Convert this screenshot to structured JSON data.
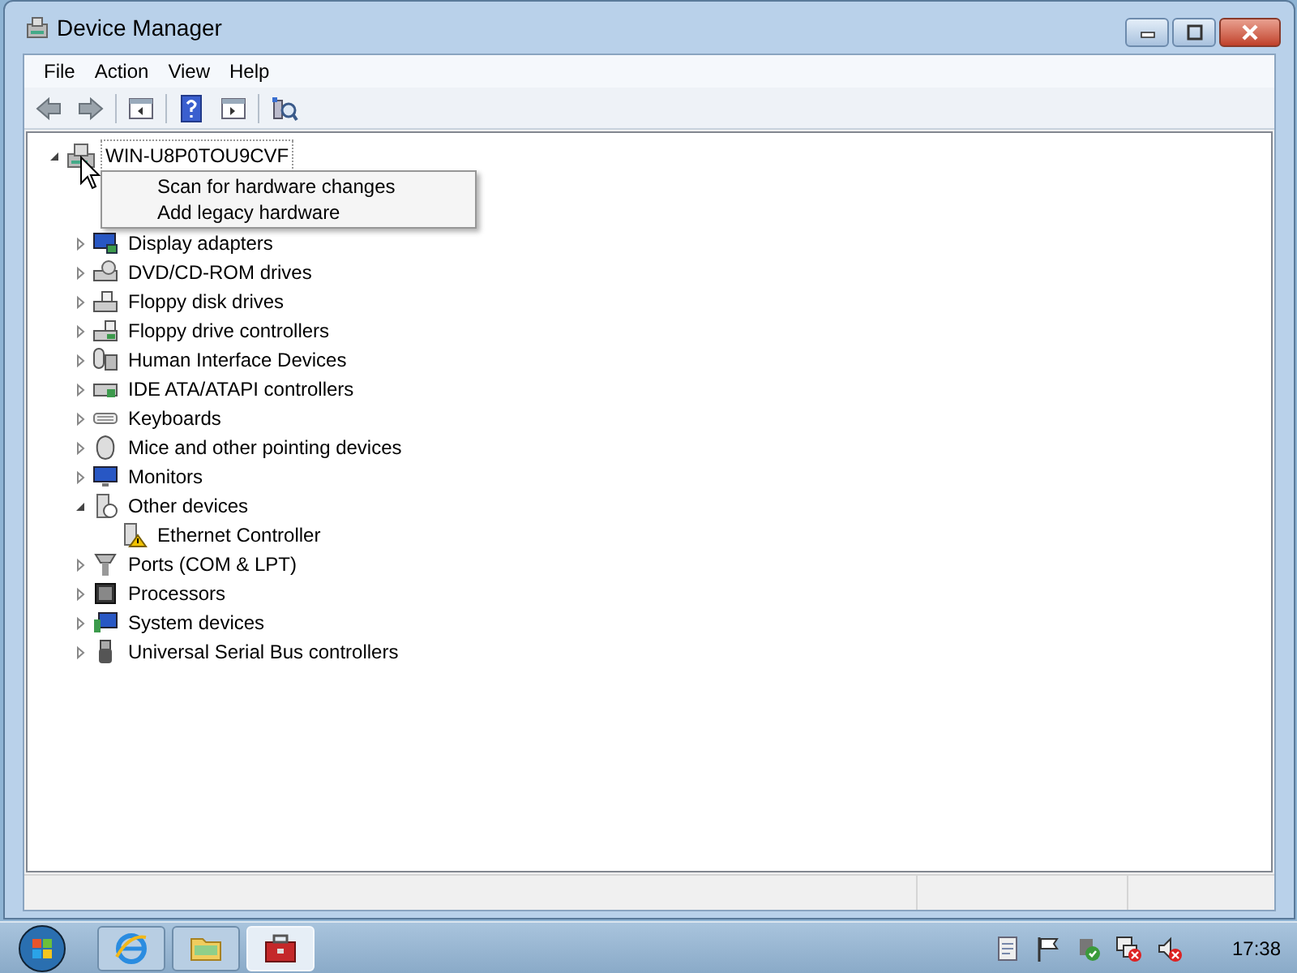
{
  "window": {
    "title": "Device Manager"
  },
  "menu_bar": [
    {
      "label": "File"
    },
    {
      "label": "Action"
    },
    {
      "label": "View"
    },
    {
      "label": "Help"
    }
  ],
  "tree": {
    "root": {
      "label": "WIN-U8P0TOU9CVF",
      "expanded": true,
      "selected": true
    },
    "children": [
      {
        "label": "Display adapters",
        "expanded": false,
        "selected": false
      },
      {
        "label": "DVD/CD-ROM drives",
        "expanded": false,
        "selected": false
      },
      {
        "label": "Floppy disk drives",
        "expanded": false,
        "selected": false
      },
      {
        "label": "Floppy drive controllers",
        "expanded": false,
        "selected": false
      },
      {
        "label": "Human Interface Devices",
        "expanded": false,
        "selected": false
      },
      {
        "label": "IDE ATA/ATAPI controllers",
        "expanded": false,
        "selected": false
      },
      {
        "label": "Keyboards",
        "expanded": false,
        "selected": false
      },
      {
        "label": "Mice and other pointing devices",
        "expanded": false,
        "selected": false
      },
      {
        "label": "Monitors",
        "expanded": false,
        "selected": false
      },
      {
        "label": "Other devices",
        "expanded": true,
        "selected": false,
        "children": [
          {
            "label": "Ethernet Controller",
            "selected": false
          }
        ]
      },
      {
        "label": "Ports (COM & LPT)",
        "expanded": false,
        "selected": false
      },
      {
        "label": "Processors",
        "expanded": false,
        "selected": false
      },
      {
        "label": "System devices",
        "expanded": false,
        "selected": false
      },
      {
        "label": "Universal Serial Bus controllers",
        "expanded": false,
        "selected": false
      }
    ]
  },
  "context_menu": [
    {
      "label": "Scan for hardware changes"
    },
    {
      "label": "Add legacy hardware"
    }
  ],
  "taskbar": {
    "buttons": [
      {
        "selected": false
      },
      {
        "selected": false
      },
      {
        "selected": true
      }
    ],
    "clock": "17:38"
  }
}
